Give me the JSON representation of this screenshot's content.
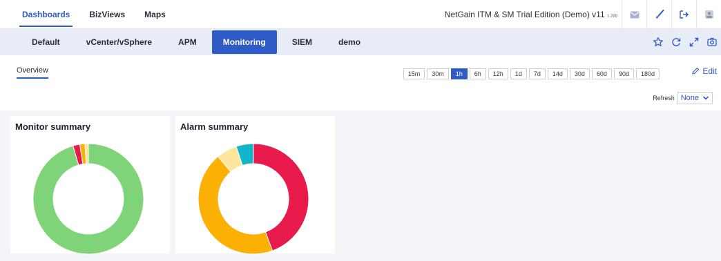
{
  "topnav": {
    "items": [
      {
        "label": "Dashboards",
        "active": true
      },
      {
        "label": "BizViews",
        "active": false
      },
      {
        "label": "Maps",
        "active": false
      }
    ],
    "product": "NetGain ITM & SM Trial Edition (Demo) v11",
    "version_suffix": "1.299",
    "icons": [
      "mail-icon",
      "brush-icon",
      "logout-icon",
      "user-avatar-icon"
    ]
  },
  "tabs": {
    "items": [
      {
        "label": "Default",
        "active": false
      },
      {
        "label": "vCenter/vSphere",
        "active": false
      },
      {
        "label": "APM",
        "active": false
      },
      {
        "label": "Monitoring",
        "active": true
      },
      {
        "label": "SIEM",
        "active": false
      },
      {
        "label": "demo",
        "active": false
      }
    ],
    "icons": [
      "star-icon",
      "refresh-icon",
      "expand-icon",
      "camera-icon"
    ]
  },
  "subbar": {
    "overview_label": "Overview",
    "time_ranges": [
      "15m",
      "30m",
      "1h",
      "6h",
      "12h",
      "1d",
      "7d",
      "14d",
      "30d",
      "60d",
      "90d",
      "180d"
    ],
    "active_range": "1h",
    "edit_label": "Edit",
    "refresh_label": "Refresh",
    "refresh_value": "None"
  },
  "panels": {
    "monitor": {
      "title": "Monitor summary"
    },
    "alarm": {
      "title": "Alarm summary"
    }
  },
  "chart_data": [
    {
      "type": "pie",
      "title": "Monitor summary",
      "donut": true,
      "values": [
        95.5,
        2,
        1.5,
        1
      ],
      "colors": [
        "#7fd47a",
        "#e81a4b",
        "#fbb003",
        "#ffe69c"
      ]
    },
    {
      "type": "pie",
      "title": "Alarm summary",
      "donut": true,
      "values": [
        44,
        44,
        6,
        5
      ],
      "colors": [
        "#e81a4b",
        "#fbb003",
        "#ffe69c",
        "#13b5c8"
      ]
    }
  ]
}
